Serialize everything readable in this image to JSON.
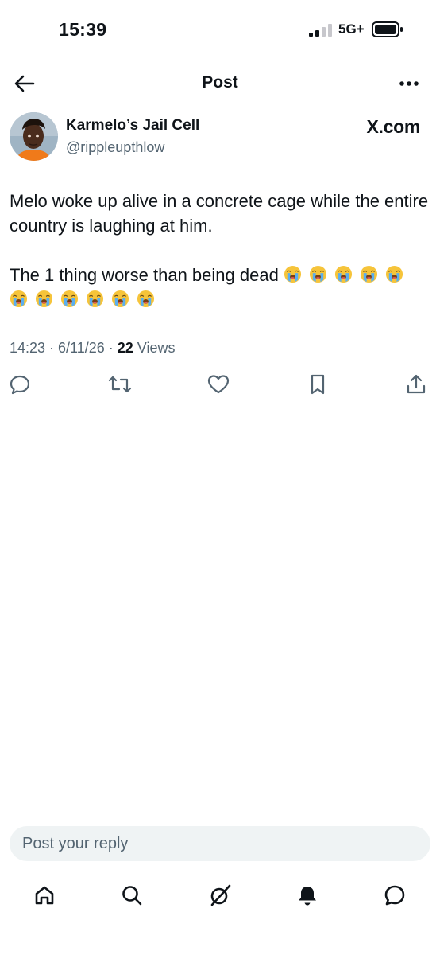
{
  "status_bar": {
    "time": "15:39",
    "network": "5G+"
  },
  "header": {
    "title": "Post",
    "back_icon": "arrow-left-icon",
    "more_icon": "more-horizontal-icon"
  },
  "post": {
    "author": {
      "display_name": "Karmelo’s Jail Cell",
      "handle": "@rippleupthlow"
    },
    "source": "X.com",
    "text_line1": "Melo woke up alive in a concrete cage while the entire country is laughing at him.",
    "text_line2": "The 1 thing worse than being dead",
    "emoji": "loudly-crying-face",
    "emoji_count": 11,
    "timestamp": "14:23 · 6/11/26 · ",
    "views_count": "22",
    "views_label": " Views"
  },
  "actions": [
    "reply-icon",
    "repost-icon",
    "like-icon",
    "bookmark-icon",
    "share-icon"
  ],
  "reply": {
    "placeholder": "Post your reply"
  },
  "tabs": [
    "home-icon",
    "search-icon",
    "grok-icon",
    "notifications-icon",
    "messages-icon"
  ],
  "colors": {
    "text": "#0f1419",
    "secondary": "#536471",
    "input_bg": "#eff3f4"
  }
}
